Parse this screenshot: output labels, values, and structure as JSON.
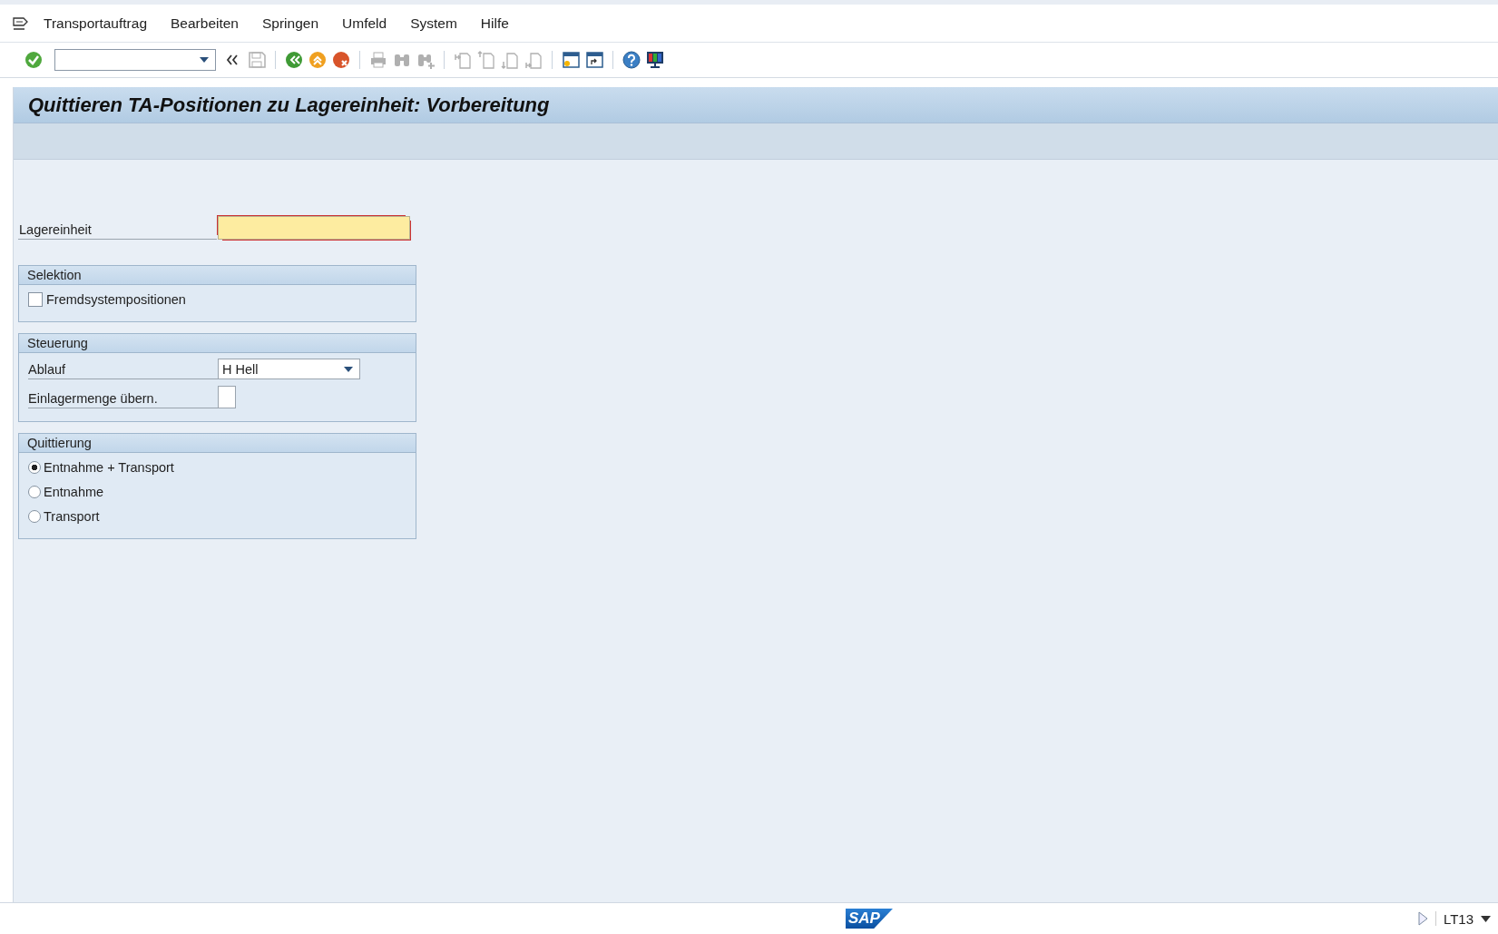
{
  "menu": [
    {
      "label": "Transportauftrag"
    },
    {
      "label": "Bearbeiten"
    },
    {
      "label": "Springen"
    },
    {
      "label": "Umfeld"
    },
    {
      "label": "System"
    },
    {
      "label": "Hilfe"
    }
  ],
  "toolbar": [
    {
      "kind": "enter",
      "disabled": false
    },
    {
      "kind": "command"
    },
    {
      "kind": "collapse",
      "disabled": false
    },
    {
      "kind": "save",
      "disabled": true
    },
    {
      "kind": "sep"
    },
    {
      "kind": "back",
      "disabled": false
    },
    {
      "kind": "exit",
      "disabled": false
    },
    {
      "kind": "cancel",
      "disabled": false
    },
    {
      "kind": "sep"
    },
    {
      "kind": "print",
      "disabled": true
    },
    {
      "kind": "find",
      "disabled": true
    },
    {
      "kind": "findnext",
      "disabled": true
    },
    {
      "kind": "sep"
    },
    {
      "kind": "first",
      "disabled": true
    },
    {
      "kind": "prev",
      "disabled": true
    },
    {
      "kind": "next",
      "disabled": true
    },
    {
      "kind": "last",
      "disabled": true
    },
    {
      "kind": "sep"
    },
    {
      "kind": "newsession",
      "disabled": false
    },
    {
      "kind": "shortcut",
      "disabled": false
    },
    {
      "kind": "sep"
    },
    {
      "kind": "help",
      "disabled": false
    },
    {
      "kind": "layout",
      "disabled": false
    }
  ],
  "title": "Quittieren TA-Positionen zu Lagereinheit: Vorbereitung",
  "storage_unit": {
    "label": "Lagereinheit",
    "required": true
  },
  "groups": [
    {
      "title": "Selektion",
      "fields": [
        {
          "kind": "checkbox",
          "label": "Fremdsystempositionen",
          "checked": false
        }
      ]
    },
    {
      "title": "Steuerung",
      "fields": [
        {
          "kind": "dropdown",
          "label": "Ablauf",
          "value": "H Hell"
        },
        {
          "kind": "input",
          "label": "Einlagermenge übern."
        }
      ]
    },
    {
      "title": "Quittierung",
      "fields": [
        {
          "kind": "radio",
          "label": "Entnahme + Transport",
          "selected": true
        },
        {
          "kind": "radio",
          "label": "Entnahme",
          "selected": false
        },
        {
          "kind": "radio",
          "label": "Transport",
          "selected": false
        }
      ]
    }
  ],
  "status_bar": {
    "logo": "SAP",
    "transaction": "LT13"
  }
}
